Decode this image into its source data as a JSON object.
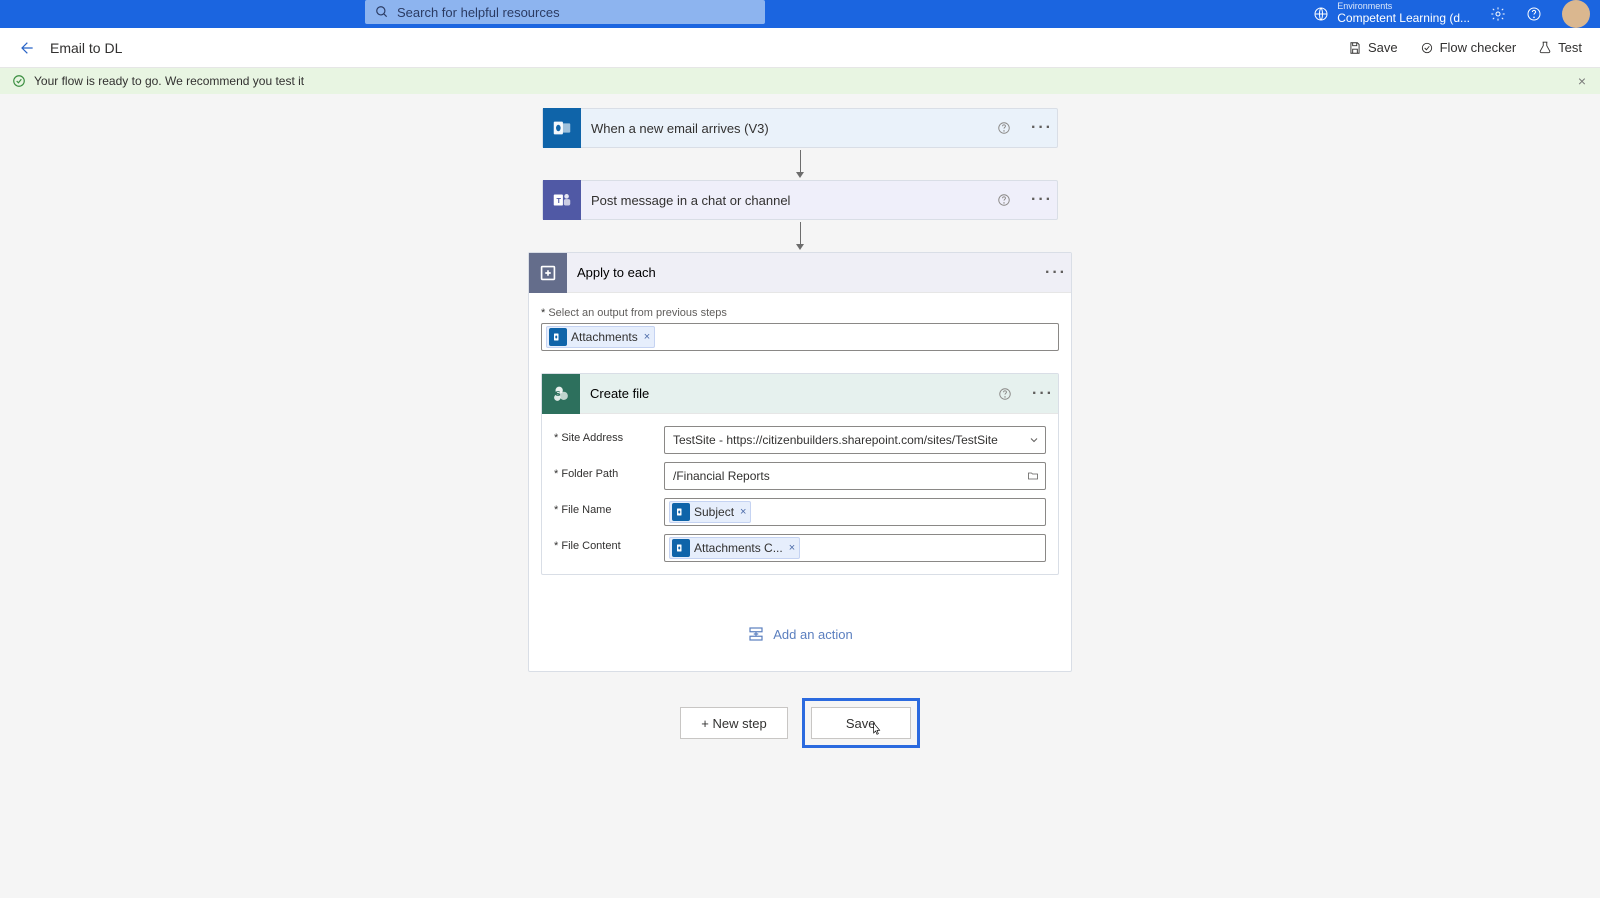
{
  "topbar": {
    "search_placeholder": "Search for helpful resources",
    "env_label": "Environments",
    "env_name": "Competent Learning (d..."
  },
  "subheader": {
    "title": "Email to DL",
    "save": "Save",
    "flow_checker": "Flow checker",
    "test": "Test"
  },
  "banner": {
    "text": "Your flow is ready to go. We recommend you test it"
  },
  "steps": {
    "trigger_label": "When a new email arrives (V3)",
    "teams_label": "Post message in a chat or channel"
  },
  "apply": {
    "title": "Apply to each",
    "field_label": "Select an output from previous steps",
    "pill_attachments": "Attachments",
    "add_action": "Add an action"
  },
  "create_file": {
    "title": "Create file",
    "site_label": "Site Address",
    "site_value": "TestSite - https://citizenbuilders.sharepoint.com/sites/TestSite",
    "folder_label": "Folder Path",
    "folder_value": "/Financial Reports",
    "filename_label": "File Name",
    "filename_pill": "Subject",
    "content_label": "File Content",
    "content_pill": "Attachments C..."
  },
  "bottom": {
    "new_step": "+ New step",
    "save": "Save"
  }
}
